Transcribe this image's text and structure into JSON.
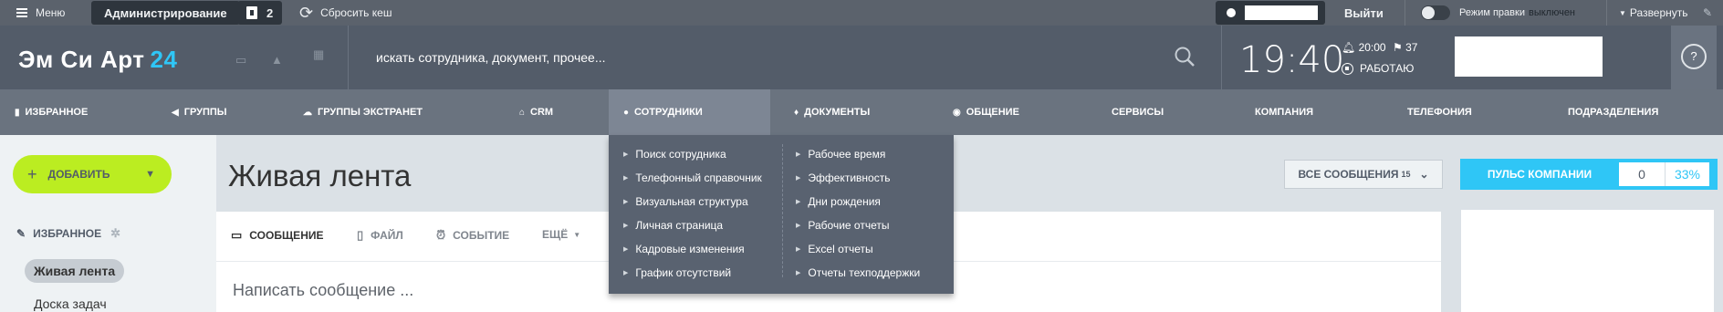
{
  "admin_bar": {
    "menu_label": "Меню",
    "admin_label": "Администрирование",
    "notif_count": "2",
    "reset_cache": "Сбросить кеш",
    "logout": "Выйти",
    "edit_mode_label": "Режим правки",
    "edit_mode_state": "выключен",
    "expand": "Развернуть"
  },
  "header": {
    "brand": "Эм Си Арт",
    "brand_suffix": "24",
    "search_placeholder": "искать сотрудника, документ, прочее...",
    "time": "19:40",
    "alarm_time": "20:00",
    "task_count": "37",
    "work_status": "РАБОТАЮ",
    "help": "?"
  },
  "nav": {
    "items": [
      {
        "label": "ИЗБРАННОЕ",
        "icon": "bookmark-icon"
      },
      {
        "label": "ГРУППЫ",
        "icon": "megaphone-icon"
      },
      {
        "label": "ГРУППЫ ЭКСТРАНЕТ",
        "icon": "cloud-icon"
      },
      {
        "label": "CRM",
        "icon": "home-icon"
      },
      {
        "label": "СОТРУДНИКИ",
        "icon": "users-icon"
      },
      {
        "label": "ДОКУМЕНТЫ",
        "icon": "bulb-icon"
      },
      {
        "label": "ОБЩЕНИЕ",
        "icon": "chat-icon"
      },
      {
        "label": "СЕРВИСЫ"
      },
      {
        "label": "КОМПАНИЯ"
      },
      {
        "label": "ТЕЛЕФОНИЯ"
      },
      {
        "label": "ПОДРАЗДЕЛЕНИЯ"
      }
    ]
  },
  "dropdown": {
    "left": [
      "Поиск сотрудника",
      "Телефонный справочник",
      "Визуальная структура",
      "Личная страница",
      "Кадровые изменения",
      "График отсутствий"
    ],
    "right": [
      "Рабочее время",
      "Эффективность",
      "Дни рождения",
      "Рабочие отчеты",
      "Excel отчеты",
      "Отчеты техподдержки"
    ]
  },
  "sidebar": {
    "add_label": "ДОБАВИТЬ",
    "favorites_title": "ИЗБРАННОЕ",
    "items": [
      "Живая лента",
      "Доска задач"
    ]
  },
  "main": {
    "title": "Живая лента",
    "filter_label": "ВСЕ СООБЩЕНИЯ",
    "filter_count": "15",
    "pulse_label": "ПУЛЬС КОМПАНИИ",
    "pulse_value": "0",
    "pulse_percent": "33%",
    "tabs": [
      "СООБЩЕНИЕ",
      "ФАЙЛ",
      "СОБЫТИЕ",
      "ЕЩЁ"
    ],
    "compose_placeholder": "Написать сообщение ..."
  },
  "colors": {
    "accent": "#2fc6f6",
    "add_button": "#bbed21",
    "header": "#535c69"
  }
}
